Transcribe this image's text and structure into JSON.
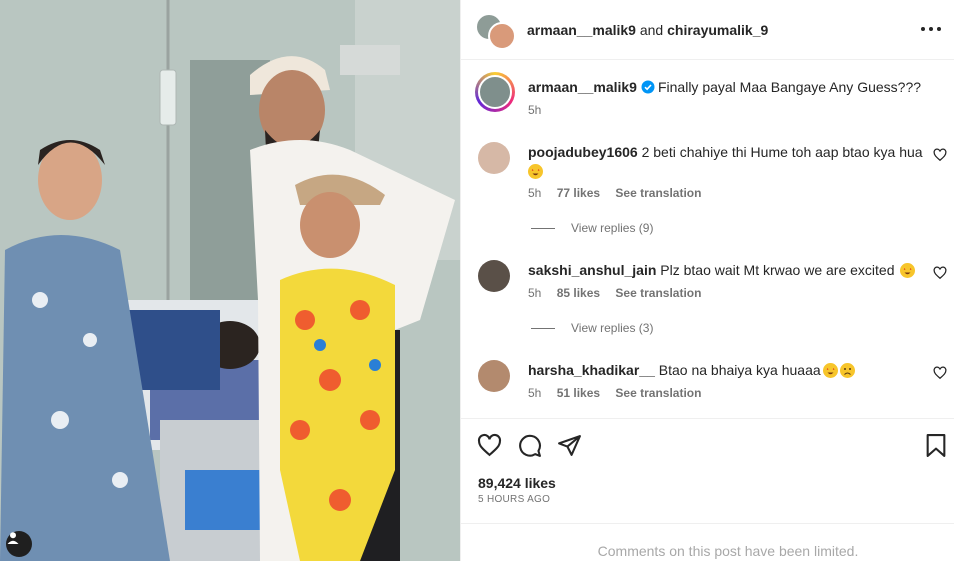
{
  "post": {
    "header_user1": "armaan__malik9",
    "header_and": "and",
    "header_user2": "chirayumalik_9",
    "caption_user": "armaan__malik9",
    "caption_text": "Finally payal Maa Bangaye Any Guess???",
    "caption_time": "5h",
    "likes": "89,424 likes",
    "posted_ago": "5 HOURS AGO",
    "comments_limited": "Comments on this post have been limited."
  },
  "comments": [
    {
      "user": "poojadubey1606",
      "text": "2 beti chahiye thi Hume toh aap btao kya hua",
      "time": "5h",
      "likes": "77 likes",
      "translate": "See translation",
      "replies": "View replies (9)"
    },
    {
      "user": "sakshi_anshul_jain",
      "text": "Plz btao wait Mt krwao we are excited",
      "time": "5h",
      "likes": "85 likes",
      "translate": "See translation",
      "replies": "View replies (3)"
    },
    {
      "user": "harsha_khadikar__",
      "text": "Btao na bhaiya kya huaaa",
      "time": "5h",
      "likes": "51 likes",
      "translate": "See translation"
    }
  ],
  "icons": {
    "more": "more-options-icon",
    "like": "heart-icon",
    "comment": "comment-icon",
    "share": "share-icon",
    "save": "bookmark-icon",
    "verified": "verified-badge-icon",
    "tag": "tagged-user-icon"
  },
  "colors": {
    "text": "#262626",
    "secondary": "#737373",
    "verified": "#0095f6",
    "divider": "#efefef"
  }
}
